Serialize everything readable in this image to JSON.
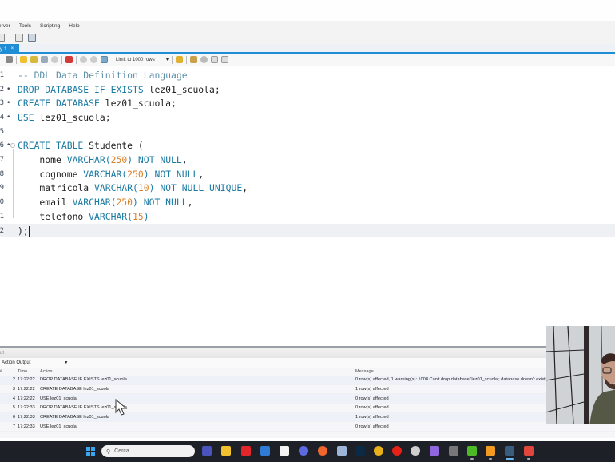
{
  "menu": [
    "erver",
    "Tools",
    "Scripting",
    "Help"
  ],
  "tab": {
    "label": "y 1",
    "close": "×"
  },
  "sql_toolbar": {
    "limit_label": "Limit to 1000 rows"
  },
  "editor": {
    "lines": [
      {
        "n": "1",
        "marker": "",
        "parts": [
          {
            "t": "-- DDL Data Definition Language",
            "c": "cm"
          }
        ]
      },
      {
        "n": "2",
        "marker": "•",
        "parts": [
          {
            "t": "DROP DATABASE IF EXISTS",
            "c": "kw"
          },
          {
            "t": " lez01_scuola;",
            "c": ""
          }
        ]
      },
      {
        "n": "3",
        "marker": "•",
        "parts": [
          {
            "t": "CREATE DATABASE",
            "c": "kw"
          },
          {
            "t": " lez01_scuola;",
            "c": ""
          }
        ]
      },
      {
        "n": "4",
        "marker": "•",
        "parts": [
          {
            "t": "USE",
            "c": "kw"
          },
          {
            "t": " lez01_scuola;",
            "c": ""
          }
        ]
      },
      {
        "n": "5",
        "marker": "",
        "parts": []
      },
      {
        "n": "6",
        "marker": "•",
        "fold": true,
        "parts": [
          {
            "t": "CREATE TABLE",
            "c": "kw"
          },
          {
            "t": " Studente (",
            "c": ""
          }
        ]
      },
      {
        "n": "7",
        "marker": "",
        "parts": [
          {
            "t": "    nome ",
            "c": ""
          },
          {
            "t": "VARCHAR(",
            "c": "kw"
          },
          {
            "t": "250",
            "c": "num"
          },
          {
            "t": ") NOT NULL",
            "c": "kw"
          },
          {
            "t": ",",
            "c": ""
          }
        ]
      },
      {
        "n": "8",
        "marker": "",
        "parts": [
          {
            "t": "    cognome ",
            "c": ""
          },
          {
            "t": "VARCHAR(",
            "c": "kw"
          },
          {
            "t": "250",
            "c": "num"
          },
          {
            "t": ") NOT NULL",
            "c": "kw"
          },
          {
            "t": ",",
            "c": ""
          }
        ]
      },
      {
        "n": "9",
        "marker": "",
        "parts": [
          {
            "t": "    matricola ",
            "c": ""
          },
          {
            "t": "VARCHAR(",
            "c": "kw"
          },
          {
            "t": "10",
            "c": "num"
          },
          {
            "t": ") NOT NULL UNIQUE",
            "c": "kw"
          },
          {
            "t": ",",
            "c": ""
          }
        ]
      },
      {
        "n": "0",
        "marker": "",
        "parts": [
          {
            "t": "    email ",
            "c": ""
          },
          {
            "t": "VARCHAR(",
            "c": "kw"
          },
          {
            "t": "250",
            "c": "num"
          },
          {
            "t": ") NOT NULL",
            "c": "kw"
          },
          {
            "t": ",",
            "c": ""
          }
        ]
      },
      {
        "n": "1",
        "marker": "",
        "parts": [
          {
            "t": "    telefono ",
            "c": ""
          },
          {
            "t": "VARCHAR(",
            "c": "kw"
          },
          {
            "t": "15",
            "c": "num"
          },
          {
            "t": ")",
            "c": "kw"
          }
        ]
      },
      {
        "n": "2",
        "marker": "",
        "active": true,
        "caret": true,
        "parts": [
          {
            "t": ");",
            "c": ""
          }
        ]
      }
    ]
  },
  "output": {
    "header": "ut",
    "selector": "Action Output",
    "columns": {
      "num": "#",
      "time": "Time",
      "action": "Action",
      "message": "Message"
    },
    "rows": [
      {
        "num": "2",
        "time": "17:22:22",
        "action": "DROP DATABASE IF EXISTS lez01_scuola",
        "message": "0 row(s) affected, 1 warning(s): 1008 Can't drop database 'lez01_scuola'; database doesn't exist"
      },
      {
        "num": "3",
        "time": "17:22:22",
        "action": "CREATE DATABASE lez01_scuola",
        "message": "1 row(s) affected"
      },
      {
        "num": "4",
        "time": "17:22:22",
        "action": "USE lez01_scuola",
        "message": "0 row(s) affected"
      },
      {
        "num": "5",
        "time": "17:22:33",
        "action": "DROP DATABASE IF EXISTS lez01_scuola",
        "message": "0 row(s) affected"
      },
      {
        "num": "6",
        "time": "17:22:33",
        "action": "CREATE DATABASE lez01_scuola",
        "message": "1 row(s) affected"
      },
      {
        "num": "7",
        "time": "17:22:33",
        "action": "USE lez01_scuola",
        "message": "0 row(s) affected"
      }
    ]
  },
  "taskbar": {
    "search_placeholder": "Cerca",
    "apps": [
      {
        "name": "teams-icon",
        "color": "#4b53bc"
      },
      {
        "name": "file-explorer-icon",
        "color": "#f2c12e"
      },
      {
        "name": "red-diamond-app-icon",
        "color": "#e3262c"
      },
      {
        "name": "trello-icon",
        "color": "#2f7bd6"
      },
      {
        "name": "typora-icon",
        "color": "#f3f3f3"
      },
      {
        "name": "chat-app-icon",
        "color": "#5b6ae0"
      },
      {
        "name": "firefox-icon",
        "color": "#f0662c"
      },
      {
        "name": "virtualbox-icon",
        "color": "#9cb5d8"
      },
      {
        "name": "photoshop-icon",
        "color": "#0c2a44"
      },
      {
        "name": "chrome-icon",
        "color": "#e8b01a"
      },
      {
        "name": "youtube-music-icon",
        "color": "#e62117"
      },
      {
        "name": "obs-icon",
        "color": "#cfcfcf"
      },
      {
        "name": "gamepad-icon",
        "color": "#8f66e0"
      },
      {
        "name": "tray-app-icon",
        "color": "#777777"
      },
      {
        "name": "camtasia-green-icon",
        "color": "#4dbb27"
      },
      {
        "name": "orange-app-icon",
        "color": "#f29a22"
      },
      {
        "name": "mysql-workbench-icon",
        "color": "#3b5d7d"
      },
      {
        "name": "camtasia-red-icon",
        "color": "#e2453c"
      }
    ]
  }
}
